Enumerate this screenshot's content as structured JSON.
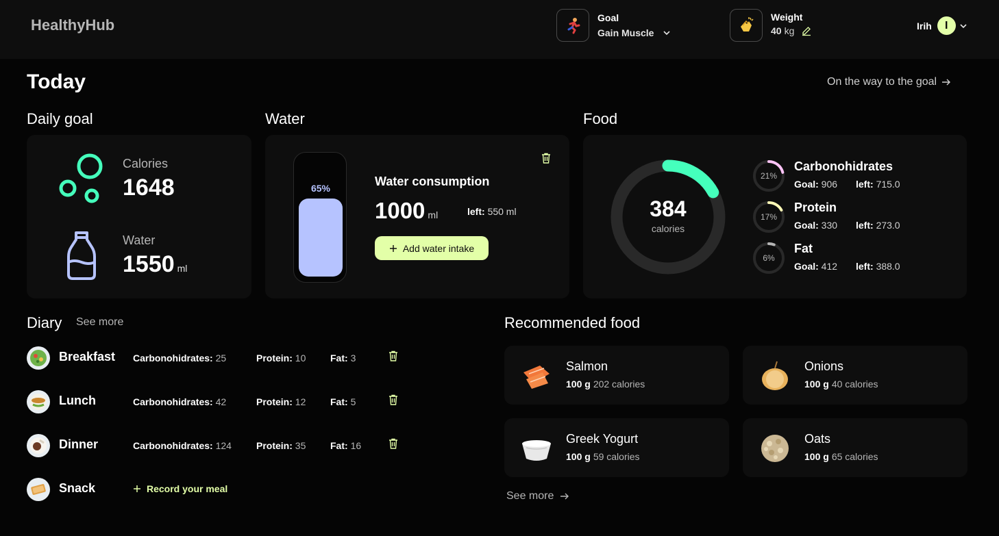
{
  "header": {
    "logo": "HealthyHub",
    "goal": {
      "label": "Goal",
      "value": "Gain Muscle",
      "icon": "running-man-icon"
    },
    "weight": {
      "label": "Weight",
      "value": "40",
      "unit": "kg",
      "icon": "clapping-hands-icon"
    },
    "user": {
      "name": "Irih",
      "avatar_letter": "I"
    }
  },
  "page": {
    "title": "Today",
    "goal_link": "On the way to the goal"
  },
  "daily_goal": {
    "title": "Daily goal",
    "calories_label": "Calories",
    "calories_value": "1648",
    "water_label": "Water",
    "water_value": "1550",
    "water_unit": "ml"
  },
  "water": {
    "title": "Water",
    "percent_label": "65%",
    "fill_fraction": 0.65,
    "heading": "Water consumption",
    "amount": "1000",
    "unit": "ml",
    "left_label": "left:",
    "left_value": "550 ml",
    "add_button": "Add water intake"
  },
  "food": {
    "title": "Food",
    "calories": "384",
    "calories_label": "calories",
    "ring_fraction": 0.17,
    "macros": [
      {
        "name": "Carbonohidrates",
        "pct": "21%",
        "fraction": 0.21,
        "goal_label": "Goal:",
        "goal": "906",
        "left_label": "left:",
        "left": "715.0",
        "color": "#ffc4f7"
      },
      {
        "name": "Protein",
        "pct": "17%",
        "fraction": 0.17,
        "goal_label": "Goal:",
        "goal": "330",
        "left_label": "left:",
        "left": "273.0",
        "color": "#fffbb7"
      },
      {
        "name": "Fat",
        "pct": "6%",
        "fraction": 0.06,
        "goal_label": "Goal:",
        "goal": "412",
        "left_label": "left:",
        "left": "388.0",
        "color": "#b6b6b6"
      }
    ]
  },
  "diary": {
    "title": "Diary",
    "see_more": "See more",
    "meals": [
      {
        "name": "Breakfast",
        "carbs_label": "Carbonohidrates:",
        "carbs": "25",
        "protein_label": "Protein:",
        "protein": "10",
        "fat_label": "Fat:",
        "fat": "3"
      },
      {
        "name": "Lunch",
        "carbs_label": "Carbonohidrates:",
        "carbs": "42",
        "protein_label": "Protein:",
        "protein": "12",
        "fat_label": "Fat:",
        "fat": "5"
      },
      {
        "name": "Dinner",
        "carbs_label": "Carbonohidrates:",
        "carbs": "124",
        "protein_label": "Protein:",
        "protein": "35",
        "fat_label": "Fat:",
        "fat": "16"
      }
    ],
    "snack": {
      "name": "Snack",
      "record": "Record your meal"
    }
  },
  "recommended": {
    "title": "Recommended food",
    "items": [
      {
        "name": "Salmon",
        "qty": "100 g",
        "cal": "202 calories"
      },
      {
        "name": "Onions",
        "qty": "100 g",
        "cal": "40 calories"
      },
      {
        "name": "Greek Yogurt",
        "qty": "100 g",
        "cal": "59 calories"
      },
      {
        "name": "Oats",
        "qty": "100 g",
        "cal": "65 calories"
      }
    ],
    "see_more": "See more"
  },
  "colors": {
    "accent_green": "#45ffbc",
    "accent_lime": "#e3ffa8",
    "water_blue": "#b6c3ff",
    "card_bg": "#0e0e0e"
  }
}
